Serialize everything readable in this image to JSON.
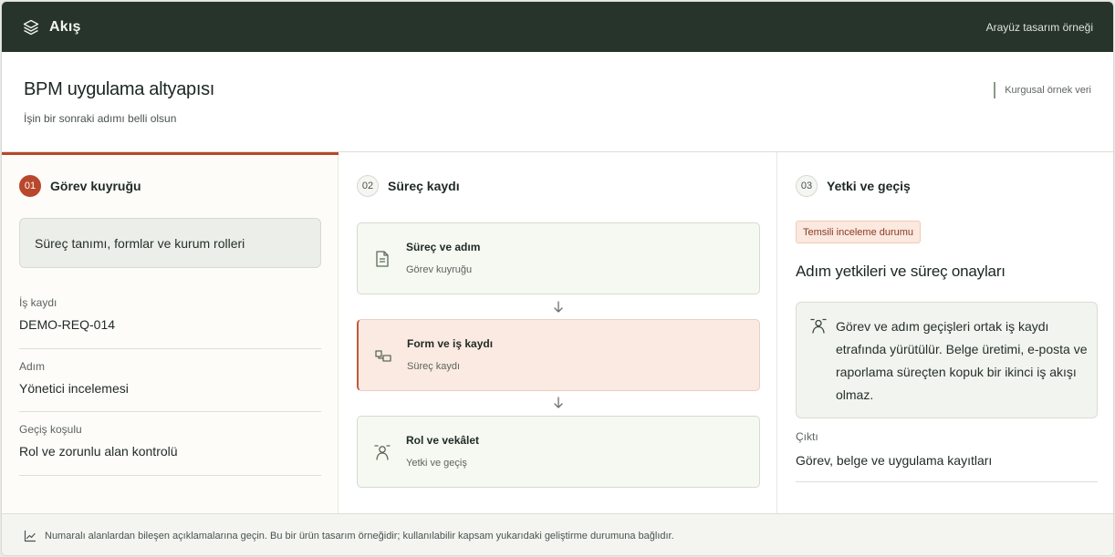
{
  "topbar": {
    "brand": "Akış",
    "brand_icon": "layers-icon",
    "right_text": "Arayüz tasarım örneği"
  },
  "header": {
    "title": "BPM uygulama altyapısı",
    "subtitle": "İşin bir sonraki adımı belli olsun",
    "note": "Kurgusal örnek veri"
  },
  "col1": {
    "num": "01",
    "title": "Görev kuyruğu",
    "tag": "Süreç tanımı, formlar ve kurum rolleri",
    "fields": [
      {
        "label": "İş kaydı",
        "value": "DEMO-REQ-014"
      },
      {
        "label": "Adım",
        "value": "Yönetici incelemesi"
      },
      {
        "label": "Geçiş koşulu",
        "value": "Rol ve zorunlu alan kontrolü"
      }
    ]
  },
  "col2": {
    "num": "02",
    "title": "Süreç kaydı",
    "steps": [
      {
        "title": "Süreç ve adım",
        "sub": "Görev kuyruğu",
        "icon": "document-icon"
      },
      {
        "title": "Form ve iş kaydı",
        "sub": "Süreç kaydı",
        "icon": "workflow-icon"
      },
      {
        "title": "Rol ve vekâlet",
        "sub": "Yetki ve geçiş",
        "icon": "user-icon"
      }
    ]
  },
  "col3": {
    "num": "03",
    "title": "Yetki ve geçiş",
    "status": "Temsili inceleme durumu",
    "section_title": "Adım yetkileri ve süreç onayları",
    "info": "Görev ve adım geçişleri ortak iş kaydı etrafında yürütülür. Belge üretimi, e-posta ve raporlama süreçten kopuk bir ikinci iş akışı olmaz.",
    "output_label": "Çıktı",
    "output_value": "Görev, belge ve uygulama kayıtları"
  },
  "footer": {
    "text": "Numaralı alanlardan bileşen açıklamalarına geçin. Bu bir ürün tasarım örneğidir; kullanılabilir kapsam yukarıdaki geliştirme durumuna bağlıdır."
  },
  "colors": {
    "topbar": "#26342c",
    "accent": "#b9472b",
    "step_bg": "#f6f8f2",
    "step_highlight_bg": "#fbeae2"
  }
}
